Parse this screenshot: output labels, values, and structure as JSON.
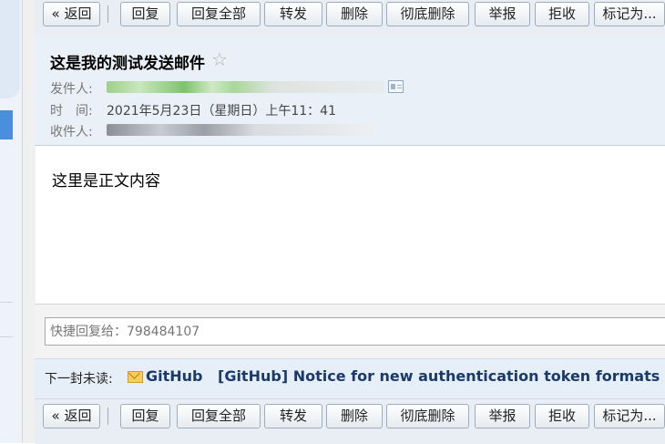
{
  "toolbar": {
    "back": "« 返回",
    "reply": "回复",
    "reply_all": "回复全部",
    "forward": "转发",
    "delete": "删除",
    "delete_permanent": "彻底删除",
    "report": "举报",
    "reject": "拒收",
    "mark_as": "标记为..."
  },
  "mail": {
    "subject": "这是我的测试发送邮件",
    "star_icon": "☆",
    "sender_label": "发件人:",
    "time_label": "时　间:",
    "time_value": "2021年5月23日（星期日）上午11：41",
    "recipient_label": "收件人:",
    "body": "这里是正文内容"
  },
  "quick_reply": {
    "placeholder": "快捷回复给：798484107"
  },
  "next_unread": {
    "label": "下一封未读:",
    "sender": "GitHub",
    "subject": "[GitHub] Notice for new authentication token formats"
  },
  "colors": {
    "header_bg": "#eaf0f8",
    "toolbar_bg": "#e9eef4",
    "link_blue": "#1a3a6b",
    "sender_blur_green": "#7fc36a"
  }
}
